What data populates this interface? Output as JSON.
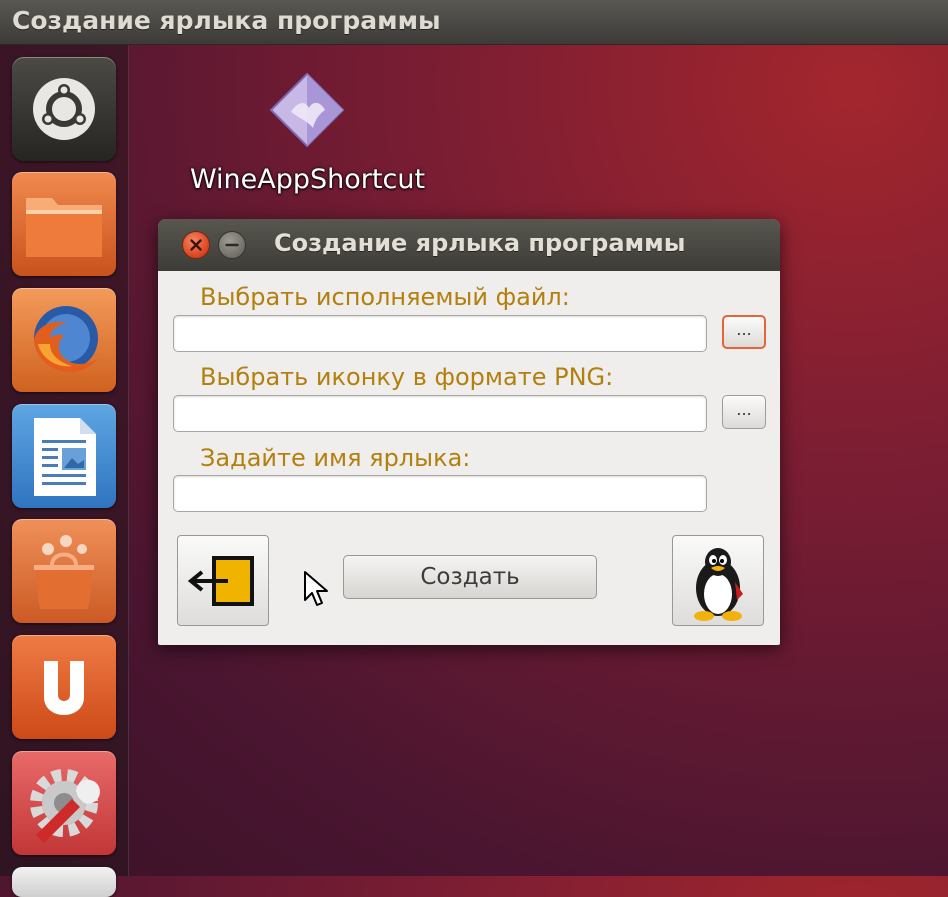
{
  "top_panel": {
    "title": "Создание ярлыка программы"
  },
  "launcher": {
    "items": [
      {
        "name": "dash-home",
        "icon": "ubuntu-logo-icon"
      },
      {
        "name": "files",
        "icon": "folder-icon"
      },
      {
        "name": "firefox",
        "icon": "firefox-icon"
      },
      {
        "name": "libreoffice-writer",
        "icon": "writer-document-icon"
      },
      {
        "name": "software-center",
        "icon": "shopping-bag-icon"
      },
      {
        "name": "ubuntu-one",
        "icon": "ubuntu-one-icon"
      },
      {
        "name": "system-settings",
        "icon": "gear-wrench-icon"
      }
    ]
  },
  "desktop": {
    "shortcut_label": "WineAppShortcut",
    "shortcut_icon": "wine-diamond-icon"
  },
  "dialog": {
    "title": "Создание ярлыка программы",
    "exec_label": "Выбрать исполняемый файл:",
    "exec_value": "",
    "exec_browse": "...",
    "icon_label": "Выбрать иконку в формате PNG:",
    "icon_value": "",
    "icon_browse": "...",
    "name_label": "Задайте имя ярлыка:",
    "name_value": "",
    "create_button": "Создать",
    "exit_icon": "exit-door-icon",
    "about_icon": "tux-penguin-icon"
  },
  "colors": {
    "label_color": "#b3800e",
    "focus_border": "#e7633c",
    "panel": "#3c3b37",
    "close_button": "#df4b23"
  }
}
